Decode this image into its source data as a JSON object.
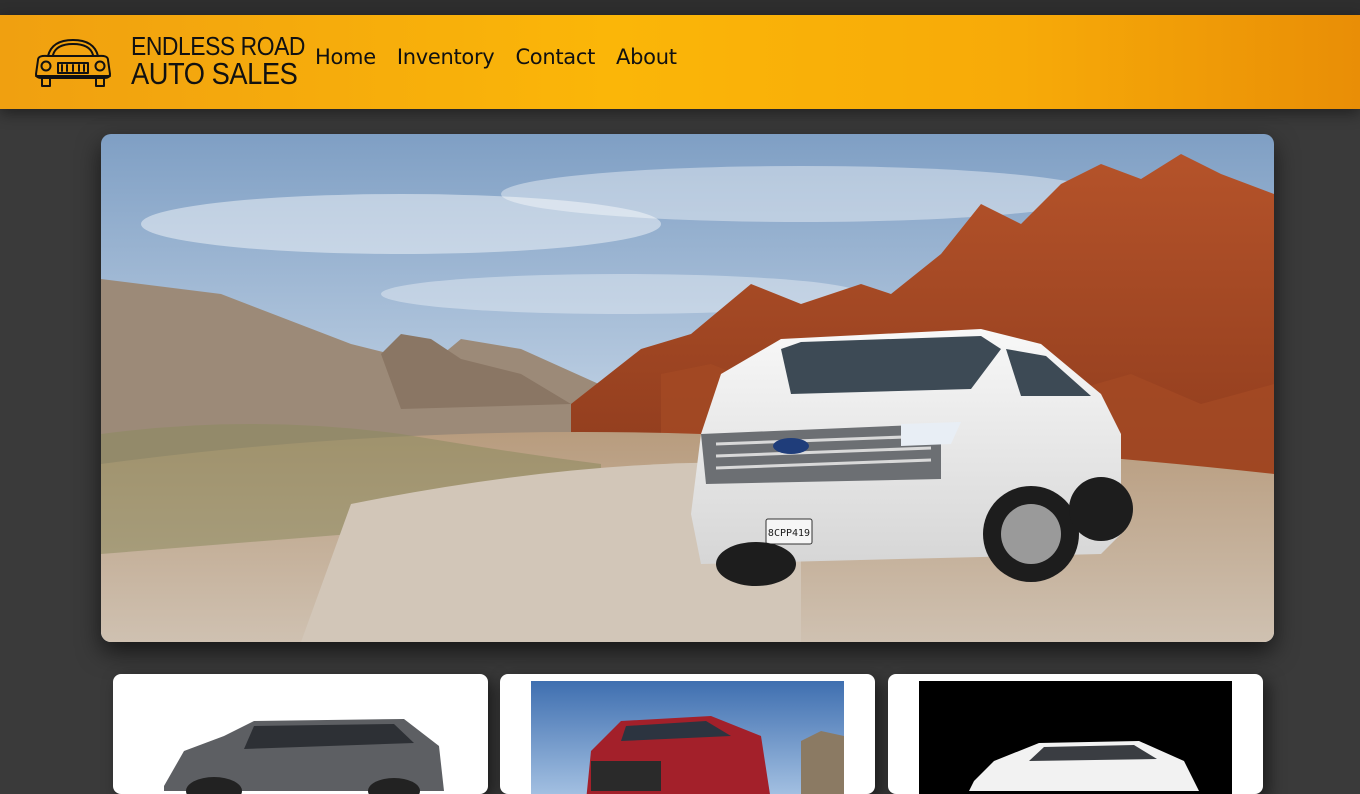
{
  "header": {
    "brand_line1": "ENDLESS ROAD",
    "brand_line2": "AUTO SALES",
    "logo_icon": "vintage-car-icon",
    "nav": [
      {
        "label": "Home"
      },
      {
        "label": "Inventory"
      },
      {
        "label": "Contact"
      },
      {
        "label": "About"
      }
    ]
  },
  "hero": {
    "plate_text": "8CPP419"
  },
  "colors": {
    "header_accent": "#fbb608",
    "page_background": "#3a3a3a",
    "card_background": "#ffffff"
  }
}
